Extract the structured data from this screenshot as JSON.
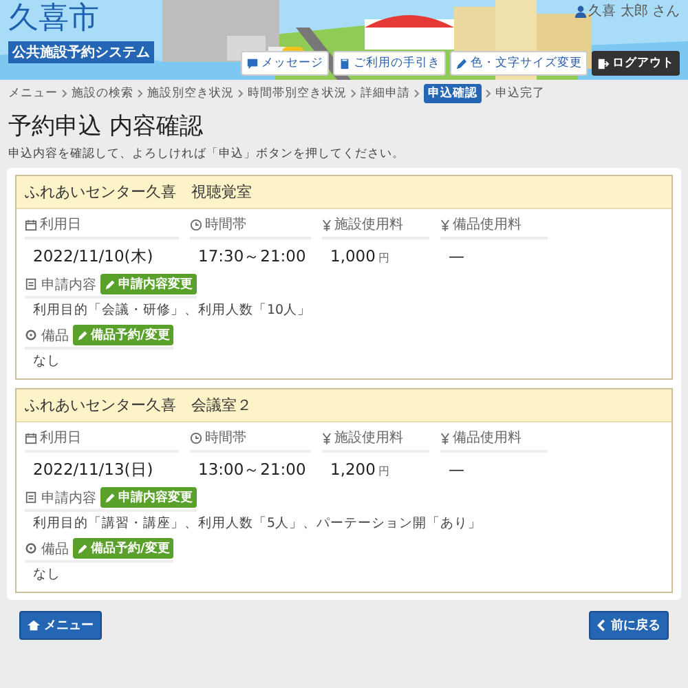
{
  "header": {
    "city": "久喜市",
    "system": "公共施設予約システム",
    "user": "久喜 太郎 さん",
    "buttons": [
      {
        "kind": "message",
        "label": "メッセージ"
      },
      {
        "kind": "guide",
        "label": "ご利用の手引き"
      },
      {
        "kind": "style",
        "label": "色・文字サイズ変更"
      },
      {
        "kind": "logout",
        "label": "ログアウト"
      }
    ]
  },
  "breadcrumb": [
    {
      "label": "メニュー",
      "selected": false
    },
    {
      "label": "施設の検索",
      "selected": false
    },
    {
      "label": "施設別空き状況",
      "selected": false
    },
    {
      "label": "時間帯別空き状況",
      "selected": false
    },
    {
      "label": "詳細申請",
      "selected": false
    },
    {
      "label": "申込確認",
      "selected": true
    },
    {
      "label": "申込完了",
      "selected": false
    }
  ],
  "page": {
    "title": "予約申込 内容確認",
    "instruction": "申込内容を確認して、よろしければ「申込」ボタンを押してください。"
  },
  "reservations": [
    {
      "facility": "ふれあいセンター久喜　視聴覚室",
      "fields": [
        {
          "kind": "date",
          "label": "利用日",
          "value": "2022/11/10(木)"
        },
        {
          "kind": "time",
          "label": "時間帯",
          "value": "17:30～21:00"
        },
        {
          "kind": "fee",
          "label": "施設使用料",
          "value": "1,000",
          "unit": "円"
        },
        {
          "kind": "fee",
          "label": "備品使用料",
          "value": "—"
        }
      ],
      "sections": [
        {
          "kind": "application",
          "label": "申請内容",
          "button": "申請内容変更",
          "text": "利用目的「会議・研修」、利用人数「10人」"
        },
        {
          "kind": "equipment",
          "label": "備品",
          "button": "備品予約/変更",
          "text": "なし"
        }
      ]
    },
    {
      "facility": "ふれあいセンター久喜　会議室２",
      "fields": [
        {
          "kind": "date",
          "label": "利用日",
          "value": "2022/11/13(日)"
        },
        {
          "kind": "time",
          "label": "時間帯",
          "value": "13:00～21:00"
        },
        {
          "kind": "fee",
          "label": "施設使用料",
          "value": "1,200",
          "unit": "円"
        },
        {
          "kind": "fee",
          "label": "備品使用料",
          "value": "—"
        }
      ],
      "sections": [
        {
          "kind": "application",
          "label": "申請内容",
          "button": "申請内容変更",
          "text": "利用目的「講習・講座」、利用人数「5人」、パーテーション開「あり」"
        },
        {
          "kind": "equipment",
          "label": "備品",
          "button": "備品予約/変更",
          "text": "なし"
        }
      ]
    }
  ],
  "footer": {
    "buttons": [
      {
        "kind": "menu",
        "label": "メニュー"
      },
      {
        "kind": "back",
        "label": "前に戻る"
      }
    ]
  }
}
